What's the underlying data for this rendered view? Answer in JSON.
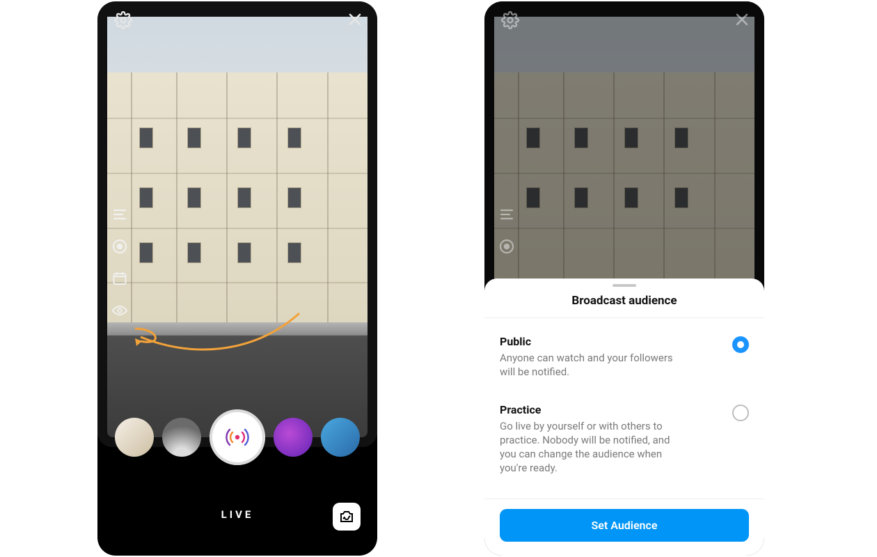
{
  "left": {
    "mode_label": "LIVE",
    "top_icons": {
      "settings": "gear-icon",
      "close": "close-icon"
    },
    "side_tools": [
      "title-icon",
      "visibility-icon",
      "schedule-icon",
      "audience-icon"
    ],
    "annotation": "arrow-to-audience",
    "carousel_items": 5
  },
  "right": {
    "sheet": {
      "title": "Broadcast audience",
      "options": [
        {
          "name": "Public",
          "description": "Anyone can watch and your followers will be notified.",
          "selected": true
        },
        {
          "name": "Practice",
          "description": "Go live by yourself or with others to practice. Nobody will be notified, and you can change the audience when you're ready.",
          "selected": false
        }
      ],
      "primary_button": "Set Audience"
    }
  }
}
